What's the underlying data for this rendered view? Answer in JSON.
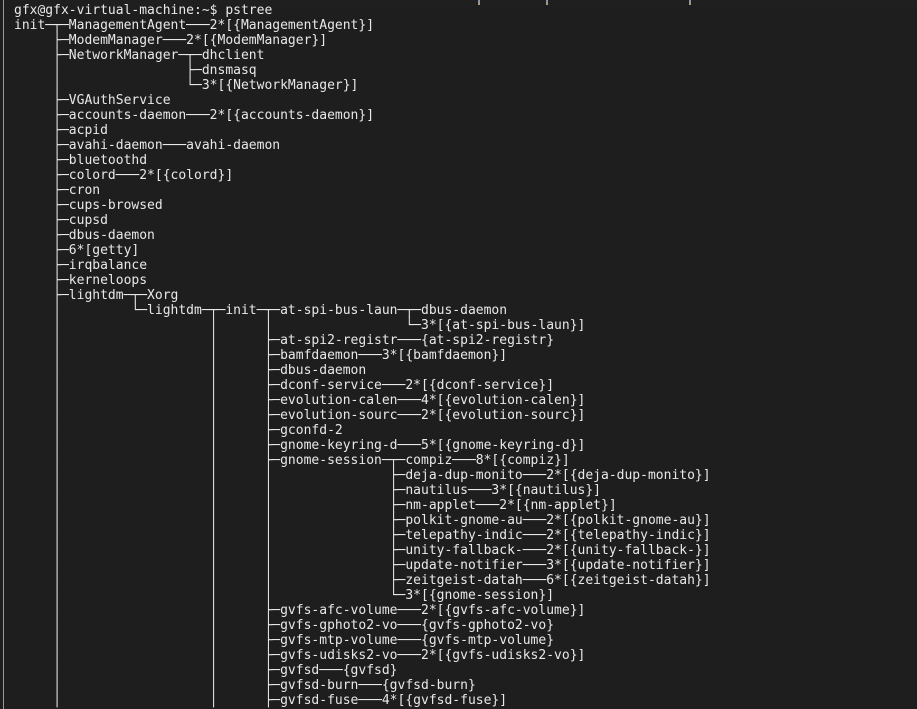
{
  "window": {
    "kind": "terminal-emulator",
    "background_color": "#1e1e1e",
    "text_color": "#e8e8e8",
    "border_color": "#9a9a9a"
  },
  "terminal": {
    "prompt": "gfx@gfx-virtual-machine:~$",
    "user": "gfx",
    "host": "gfx-virtual-machine",
    "cwd": "~",
    "command": "pstree",
    "prompt_line": "gfx@gfx-virtual-machine:~$ pstree",
    "lines": [
      "gfx@gfx-virtual-machine:~$ pstree",
      "init─┬─ManagementAgent───2*[{ManagementAgent}]",
      "     ├─ModemManager───2*[{ModemManager}]",
      "     ├─NetworkManager─┬─dhclient",
      "     │                ├─dnsmasq",
      "     │                └─3*[{NetworkManager}]",
      "     ├─VGAuthService",
      "     ├─accounts-daemon───2*[{accounts-daemon}]",
      "     ├─acpid",
      "     ├─avahi-daemon───avahi-daemon",
      "     ├─bluetoothd",
      "     ├─colord───2*[{colord}]",
      "     ├─cron",
      "     ├─cups-browsed",
      "     ├─cupsd",
      "     ├─dbus-daemon",
      "     ├─6*[getty]",
      "     ├─irqbalance",
      "     ├─kerneloops",
      "     ├─lightdm─┬─Xorg",
      "     │         └─lightdm─┬─init─┬─at-spi-bus-laun─┬─dbus-daemon",
      "     │                   │      │                 └─3*[{at-spi-bus-laun}]",
      "     │                   │      ├─at-spi2-registr───{at-spi2-registr}",
      "     │                   │      ├─bamfdaemon───3*[{bamfdaemon}]",
      "     │                   │      ├─dbus-daemon",
      "     │                   │      ├─dconf-service───2*[{dconf-service}]",
      "     │                   │      ├─evolution-calen───4*[{evolution-calen}]",
      "     │                   │      ├─evolution-sourc───2*[{evolution-sourc}]",
      "     │                   │      ├─gconfd-2",
      "     │                   │      ├─gnome-keyring-d───5*[{gnome-keyring-d}]",
      "     │                   │      ├─gnome-session─┬─compiz───8*[{compiz}]",
      "     │                   │      │               ├─deja-dup-monito───2*[{deja-dup-monito}]",
      "     │                   │      │               ├─nautilus───3*[{nautilus}]",
      "     │                   │      │               ├─nm-applet───2*[{nm-applet}]",
      "     │                   │      │               ├─polkit-gnome-au───2*[{polkit-gnome-au}]",
      "     │                   │      │               ├─telepathy-indic───2*[{telepathy-indic}]",
      "     │                   │      │               ├─unity-fallback-───2*[{unity-fallback-}]",
      "     │                   │      │               ├─update-notifier───3*[{update-notifier}]",
      "     │                   │      │               ├─zeitgeist-datah───6*[{zeitgeist-datah}]",
      "     │                   │      │               └─3*[{gnome-session}]",
      "     │                   │      ├─gvfs-afc-volume───2*[{gvfs-afc-volume}]",
      "     │                   │      ├─gvfs-gphoto2-vo───{gvfs-gphoto2-vo}",
      "     │                   │      ├─gvfs-mtp-volume───{gvfs-mtp-volume}",
      "     │                   │      ├─gvfs-udisks2-vo───2*[{gvfs-udisks2-vo}]",
      "     │                   │      ├─gvfsd───{gvfsd}",
      "     │                   │      ├─gvfsd-burn───{gvfsd-burn}",
      "     │                   │      ├─gvfsd-fuse───4*[{gvfsd-fuse}]"
    ],
    "processes": [
      {
        "name": "init",
        "depth": 0
      },
      {
        "name": "ManagementAgent",
        "threads": "2*[{ManagementAgent}]",
        "depth": 1
      },
      {
        "name": "ModemManager",
        "threads": "2*[{ModemManager}]",
        "depth": 1
      },
      {
        "name": "NetworkManager",
        "depth": 1,
        "children": [
          "dhclient",
          "dnsmasq",
          "3*[{NetworkManager}]"
        ]
      },
      {
        "name": "VGAuthService",
        "depth": 1
      },
      {
        "name": "accounts-daemon",
        "threads": "2*[{accounts-daemon}]",
        "depth": 1
      },
      {
        "name": "acpid",
        "depth": 1
      },
      {
        "name": "avahi-daemon",
        "children": [
          "avahi-daemon"
        ],
        "depth": 1
      },
      {
        "name": "bluetoothd",
        "depth": 1
      },
      {
        "name": "colord",
        "threads": "2*[{colord}]",
        "depth": 1
      },
      {
        "name": "cron",
        "depth": 1
      },
      {
        "name": "cups-browsed",
        "depth": 1
      },
      {
        "name": "cupsd",
        "depth": 1
      },
      {
        "name": "dbus-daemon",
        "depth": 1
      },
      {
        "name": "6*[getty]",
        "depth": 1
      },
      {
        "name": "irqbalance",
        "depth": 1
      },
      {
        "name": "kerneloops",
        "depth": 1
      },
      {
        "name": "lightdm",
        "depth": 1,
        "children": [
          "Xorg",
          "lightdm"
        ]
      },
      {
        "name": "at-spi-bus-laun",
        "depth": 4,
        "children": [
          "dbus-daemon",
          "3*[{at-spi-bus-laun}]"
        ]
      },
      {
        "name": "at-spi2-registr",
        "threads": "{at-spi2-registr}",
        "depth": 4
      },
      {
        "name": "bamfdaemon",
        "threads": "3*[{bamfdaemon}]",
        "depth": 4
      },
      {
        "name": "dbus-daemon",
        "depth": 4
      },
      {
        "name": "dconf-service",
        "threads": "2*[{dconf-service}]",
        "depth": 4
      },
      {
        "name": "evolution-calen",
        "threads": "4*[{evolution-calen}]",
        "depth": 4
      },
      {
        "name": "evolution-sourc",
        "threads": "2*[{evolution-sourc}]",
        "depth": 4
      },
      {
        "name": "gconfd-2",
        "depth": 4
      },
      {
        "name": "gnome-keyring-d",
        "threads": "5*[{gnome-keyring-d}]",
        "depth": 4
      },
      {
        "name": "gnome-session",
        "depth": 4,
        "children": [
          "compiz",
          "deja-dup-monito",
          "nautilus",
          "nm-applet",
          "polkit-gnome-au",
          "telepathy-indic",
          "unity-fallback-",
          "update-notifier",
          "zeitgeist-datah",
          "3*[{gnome-session}]"
        ]
      },
      {
        "name": "compiz",
        "threads": "8*[{compiz}]",
        "depth": 5
      },
      {
        "name": "deja-dup-monito",
        "threads": "2*[{deja-dup-monito}]",
        "depth": 5
      },
      {
        "name": "nautilus",
        "threads": "3*[{nautilus}]",
        "depth": 5
      },
      {
        "name": "nm-applet",
        "threads": "2*[{nm-applet}]",
        "depth": 5
      },
      {
        "name": "polkit-gnome-au",
        "threads": "2*[{polkit-gnome-au}]",
        "depth": 5
      },
      {
        "name": "telepathy-indic",
        "threads": "2*[{telepathy-indic}]",
        "depth": 5
      },
      {
        "name": "unity-fallback-",
        "threads": "2*[{unity-fallback-}]",
        "depth": 5
      },
      {
        "name": "update-notifier",
        "threads": "3*[{update-notifier}]",
        "depth": 5
      },
      {
        "name": "zeitgeist-datah",
        "threads": "6*[{zeitgeist-datah}]",
        "depth": 5
      },
      {
        "name": "gvfs-afc-volume",
        "threads": "2*[{gvfs-afc-volume}]",
        "depth": 4
      },
      {
        "name": "gvfs-gphoto2-vo",
        "threads": "{gvfs-gphoto2-vo}",
        "depth": 4
      },
      {
        "name": "gvfs-mtp-volume",
        "threads": "{gvfs-mtp-volume}",
        "depth": 4
      },
      {
        "name": "gvfs-udisks2-vo",
        "threads": "2*[{gvfs-udisks2-vo}]",
        "depth": 4
      },
      {
        "name": "gvfsd",
        "threads": "{gvfsd}",
        "depth": 4
      },
      {
        "name": "gvfsd-burn",
        "threads": "{gvfsd-burn}",
        "depth": 4
      },
      {
        "name": "gvfsd-fuse",
        "threads": "4*[{gvfsd-fuse}]",
        "depth": 4
      }
    ]
  }
}
